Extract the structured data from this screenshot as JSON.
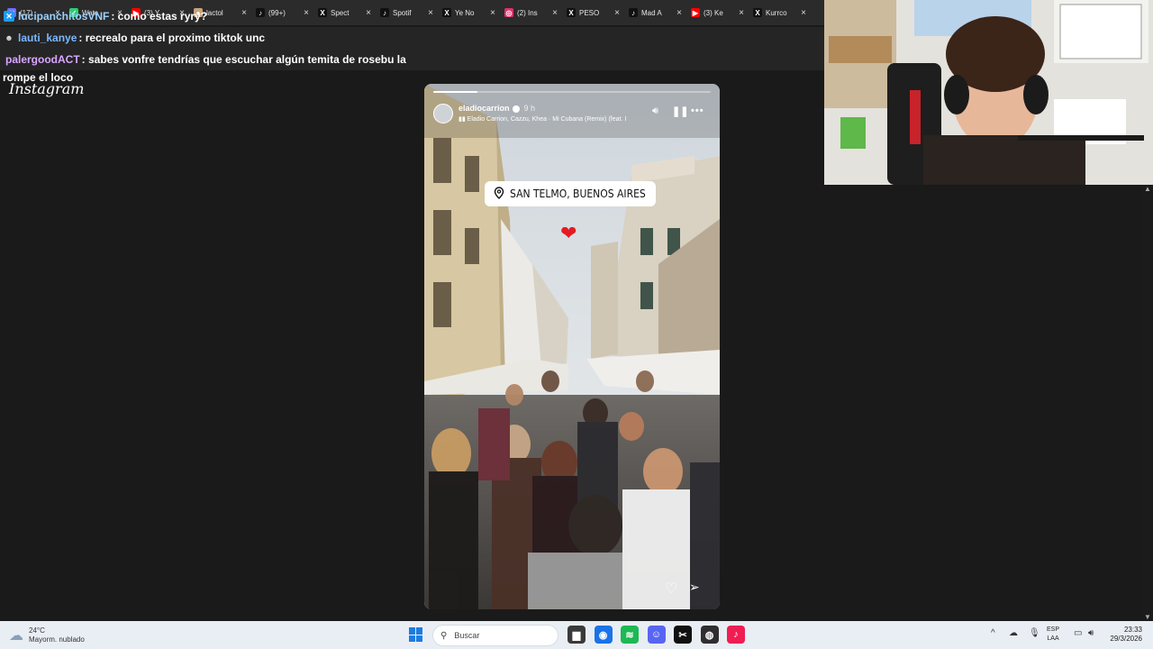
{
  "browser": {
    "tabs": [
      {
        "label": "(17)",
        "icon": "chat-icon",
        "color": "#6d6dff"
      },
      {
        "label": "Watc",
        "icon": "check-icon",
        "color": "#2ecc71"
      },
      {
        "label": "(3) Y",
        "icon": "youtube-icon",
        "color": "#ff0000"
      },
      {
        "label": "lactol",
        "icon": "avatar-icon",
        "color": "#c9a27a"
      },
      {
        "label": "(99+)",
        "icon": "tiktok-icon",
        "color": "#111111"
      },
      {
        "label": "Spect",
        "icon": "x-icon",
        "color": "#111111"
      },
      {
        "label": "Spotif",
        "icon": "tiktok-icon",
        "color": "#111111"
      },
      {
        "label": "Ye No",
        "icon": "x-icon",
        "color": "#111111"
      },
      {
        "label": "(2) Ins",
        "icon": "instagram-icon",
        "color": "#e1306c"
      },
      {
        "label": "PESO",
        "icon": "x-icon",
        "color": "#111111"
      },
      {
        "label": "Mad A",
        "icon": "tiktok-icon",
        "color": "#111111"
      },
      {
        "label": "(3) Ke",
        "icon": "youtube-icon",
        "color": "#ff0000"
      },
      {
        "label": "Kurrco",
        "icon": "x-icon",
        "color": "#111111"
      }
    ]
  },
  "chat": {
    "messages": [
      {
        "user": "lucipanchitosVNF",
        "text": ": como estas ryry?",
        "color": "#9ad0ff",
        "badge": "twitter-icon"
      },
      {
        "user": "lauti_kanye",
        "text": ": recrealo para el proximo tiktok unc",
        "color": "#7ab8ff",
        "badge": "emote-icon"
      },
      {
        "user": "palergoodACT",
        "text": ": sabes vonfre tendrías que escuchar algún temita de rosebu la",
        "color": "#d8a6ff",
        "badge": ""
      }
    ],
    "continuation": "rompe el loco"
  },
  "instagram": {
    "logo": "Instagram",
    "story": {
      "username": "eladiocarrion",
      "time": "9 h",
      "song": "Eladio Carrion, Cazzu, Khea · Mi Cubana (Remix) (feat. I",
      "location": "SAN TELMO, BUENOS AIRES",
      "progress": 0.16
    }
  },
  "taskbar": {
    "weather_temp": "24°C",
    "weather_desc": "Mayorm. nublado",
    "search_placeholder": "Buscar",
    "lang_top": "ESP",
    "lang_bottom": "LAA",
    "time": "23:33",
    "date": "29/3/2026",
    "apps": [
      {
        "name": "file-explorer-icon",
        "color": "#3a3a3a"
      },
      {
        "name": "chrome-icon",
        "color": "#1a73e8"
      },
      {
        "name": "spotify-icon",
        "color": "#1db954"
      },
      {
        "name": "discord-icon",
        "color": "#5865f2"
      },
      {
        "name": "capcut-icon",
        "color": "#111111"
      },
      {
        "name": "obs-icon",
        "color": "#302e31"
      },
      {
        "name": "tiktok-icon",
        "color": "#ee1d52"
      }
    ]
  }
}
